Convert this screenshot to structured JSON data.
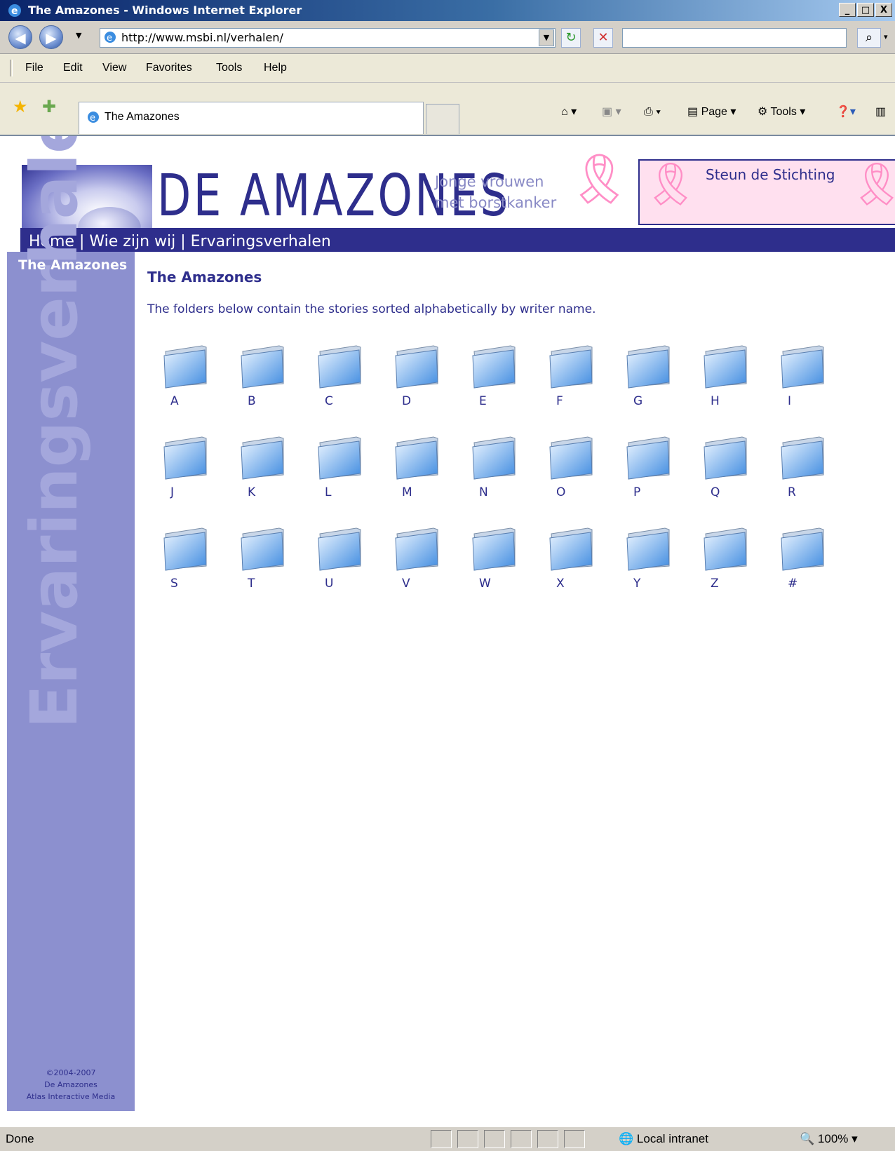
{
  "window": {
    "title": "The Amazones - Windows Internet Explorer",
    "minimize": "_",
    "maximize": "□",
    "close": "X"
  },
  "navbar": {
    "back_icon": "back-icon",
    "forward_icon": "forward-icon",
    "address": "http://www.msbi.nl/verhalen/"
  },
  "menu": {
    "items": [
      "File",
      "Edit",
      "View",
      "Favorites",
      "Tools",
      "Help"
    ]
  },
  "favbar": {
    "tab_title": "The Amazones",
    "page_label": "Page",
    "tools_label": "Tools"
  },
  "site": {
    "logo_text": "DE AMAZONES",
    "tagline_1": "Jonge vrouwen",
    "tagline_2": "met borstkanker",
    "sponsor": "Steun de Stichting",
    "nav": {
      "home": "Home",
      "about": "Wie zijn wij",
      "stories": "Ervaringsverhalen",
      "separator": "|"
    }
  },
  "sidebar": {
    "heading": "The Amazones",
    "watermark": "Ervaringsverhalen",
    "copyright_1": "©2004-2007",
    "copyright_2": "De Amazones",
    "copyright_3": "Atlas Interactive Media"
  },
  "content": {
    "title": "The Amazones",
    "intro": "The folders below contain the stories sorted alphabetically by writer name.",
    "folders": [
      "A",
      "B",
      "C",
      "D",
      "E",
      "F",
      "G",
      "H",
      "I",
      "J",
      "K",
      "L",
      "M",
      "N",
      "O",
      "P",
      "Q",
      "R",
      "S",
      "T",
      "U",
      "V",
      "W",
      "X",
      "Y",
      "Z",
      "#"
    ]
  },
  "statusbar": {
    "status": "Done",
    "zone": "Local intranet",
    "zoom": "100%"
  },
  "colors": {
    "brand": "#2e2e8c",
    "sidebar": "#8c90cf",
    "ribbon": "#ff8ec6"
  }
}
